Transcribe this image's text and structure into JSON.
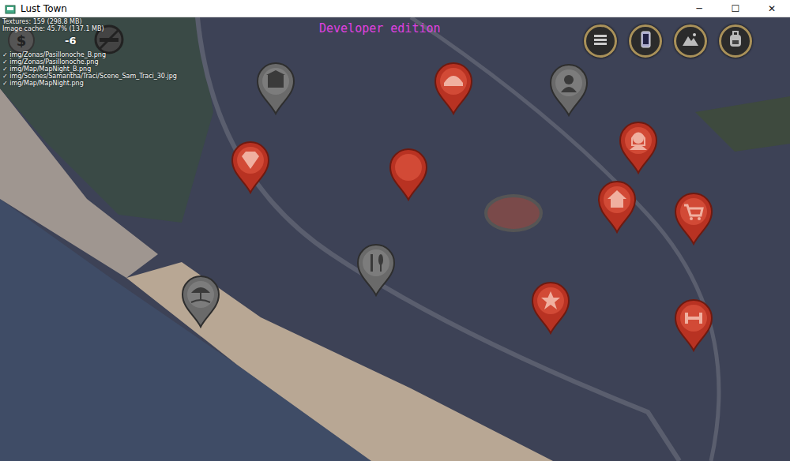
{
  "window": {
    "title": "Lust Town",
    "controls": [
      "─",
      "☐",
      "✕"
    ]
  },
  "debug": {
    "textures": "Textures: 159 (298.8 MB)",
    "image_cache": "Image cache: 45.7% (137.1 MB)",
    "files": [
      "✓ img/Zonas/Pasillonoche_B.png",
      "✓ img/Zonas/Pasillonoche.png",
      "✓ img/Map/MapNight_B.png",
      "✓ img/Scenes/Samantha/Traci/Scene_Sam_Traci_30.jpg",
      "✓ img/Map/MapNight.png"
    ]
  },
  "banner": "Developer edition",
  "money": {
    "symbol": "$",
    "amount": "-6"
  },
  "hud_buttons": [
    {
      "kind": "menu"
    },
    {
      "kind": "phone"
    },
    {
      "kind": "map"
    },
    {
      "kind": "backpack"
    }
  ],
  "pins": [
    {
      "kind": "building",
      "active": false
    },
    {
      "kind": "cop",
      "active": true
    },
    {
      "kind": "person",
      "active": false
    },
    {
      "kind": "diamond",
      "active": true
    },
    {
      "kind": "heart",
      "active": true
    },
    {
      "kind": "woman",
      "active": true
    },
    {
      "kind": "house",
      "active": true
    },
    {
      "kind": "cart",
      "active": true
    },
    {
      "kind": "food",
      "active": false
    },
    {
      "kind": "beach",
      "active": false
    },
    {
      "kind": "star",
      "active": true
    },
    {
      "kind": "gym",
      "active": true
    }
  ]
}
